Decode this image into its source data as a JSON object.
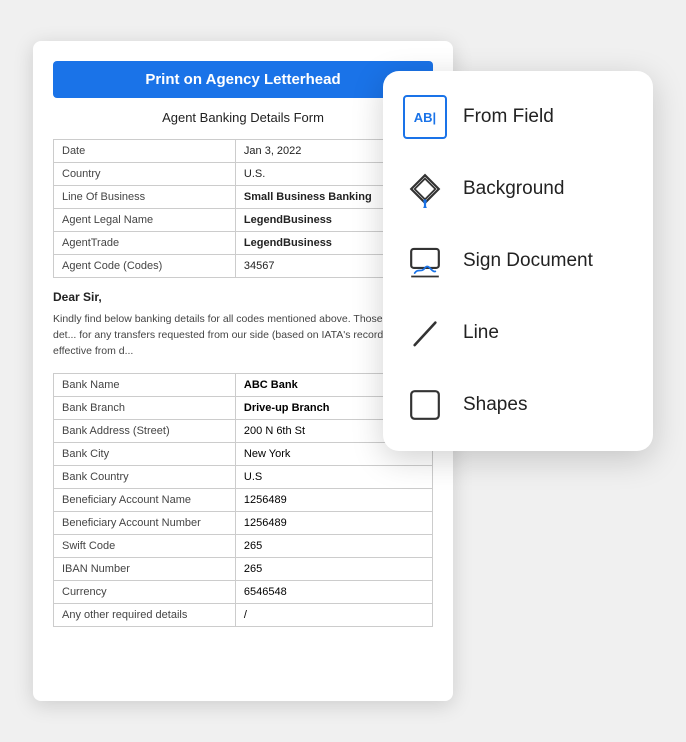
{
  "document": {
    "print_button": "Print on Agency Letterhead",
    "title": "Agent Banking Details Form",
    "info_rows": [
      {
        "label": "Date",
        "value": "Jan 3, 2022",
        "bold": false
      },
      {
        "label": "Country",
        "value": "U.S.",
        "bold": false
      },
      {
        "label": "Line Of Business",
        "value": "Small Business Banking",
        "bold": true
      },
      {
        "label": "Agent Legal Name",
        "value": "LegendBusiness",
        "bold": true
      },
      {
        "label": "AgentTrade",
        "value": "LegendBusiness",
        "bold": true
      },
      {
        "label": "Agent Code (Codes)",
        "value": "34567",
        "bold": false
      }
    ],
    "dear": "Dear Sir,",
    "body_text": "Kindly find below banking details for all codes mentioned above. Those banking det... for any transfers requested from our side (based on IATA's records) effective from d...",
    "bank_rows": [
      {
        "label": "Bank Name",
        "value": "ABC Bank",
        "bold": true
      },
      {
        "label": "Bank Branch",
        "value": "Drive-up Branch",
        "bold": true
      },
      {
        "label": "Bank Address (Street)",
        "value": "200 N 6th St",
        "bold": false
      },
      {
        "label": "Bank City",
        "value": "New York",
        "bold": false
      },
      {
        "label": "Bank Country",
        "value": "U.S",
        "bold": false
      },
      {
        "label": "Beneficiary Account Name",
        "value": "1256489",
        "bold": false
      },
      {
        "label": "Beneficiary Account Number",
        "value": "1256489",
        "bold": false
      },
      {
        "label": "Swift Code",
        "value": "265",
        "bold": false
      },
      {
        "label": "IBAN Number",
        "value": "265",
        "bold": false
      },
      {
        "label": "Currency",
        "value": "6546548",
        "bold": false
      },
      {
        "label": "Any other required details",
        "value": "/",
        "bold": false
      }
    ]
  },
  "menu": {
    "items": [
      {
        "id": "from-field",
        "label": "From Field",
        "icon": "from-field-icon"
      },
      {
        "id": "background",
        "label": "Background",
        "icon": "background-icon"
      },
      {
        "id": "sign-document",
        "label": "Sign Document",
        "icon": "sign-document-icon"
      },
      {
        "id": "line",
        "label": "Line",
        "icon": "line-icon"
      },
      {
        "id": "shapes",
        "label": "Shapes",
        "icon": "shapes-icon"
      }
    ]
  }
}
